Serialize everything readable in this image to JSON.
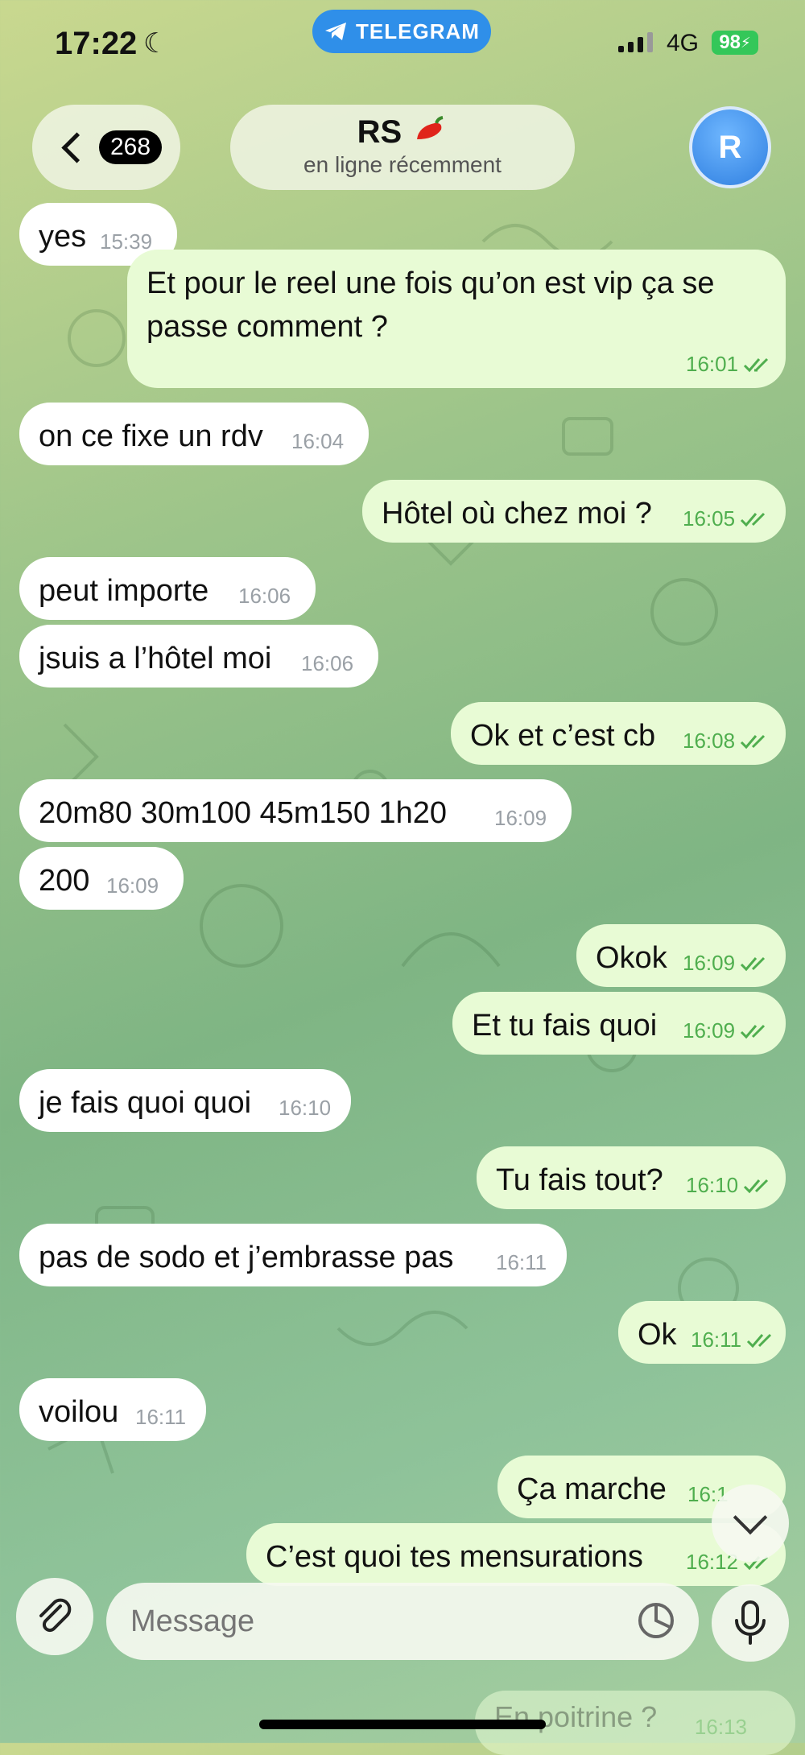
{
  "status_bar": {
    "time": "17:22",
    "network": "4G",
    "battery": "98",
    "pill_label": "TELEGRAM"
  },
  "header": {
    "back_count": "268",
    "chat_name": "RS",
    "chat_status": "en ligne récemment",
    "avatar_letter": "R"
  },
  "messages": [
    {
      "side": "in",
      "text": "yes",
      "time": "15:39"
    },
    {
      "side": "out",
      "text_line1": "Et pour le reel une fois qu’on est vip ça se",
      "text_line2": "passe comment ?",
      "time": "16:01"
    },
    {
      "side": "in",
      "text": "on ce fixe un rdv",
      "time": "16:04"
    },
    {
      "side": "out",
      "text": "Hôtel où chez moi ?",
      "time": "16:05"
    },
    {
      "side": "in",
      "text": "peut importe",
      "time": "16:06"
    },
    {
      "side": "in",
      "text": "jsuis a l’hôtel moi",
      "time": "16:06"
    },
    {
      "side": "out",
      "text": "Ok et c’est cb",
      "time": "16:08"
    },
    {
      "side": "in",
      "text": "20m80 30m100 45m150 1h20",
      "time": "16:09"
    },
    {
      "side": "in",
      "text": "200",
      "time": "16:09"
    },
    {
      "side": "out",
      "text": "Okok",
      "time": "16:09"
    },
    {
      "side": "out",
      "text": "Et tu fais quoi",
      "time": "16:09"
    },
    {
      "side": "in",
      "text": "je fais quoi quoi",
      "time": "16:10"
    },
    {
      "side": "out",
      "text": "Tu fais tout?",
      "time": "16:10"
    },
    {
      "side": "in",
      "text": "pas de sodo et j’embrasse pas",
      "time": "16:11"
    },
    {
      "side": "out",
      "text": "Ok",
      "time": "16:11"
    },
    {
      "side": "in",
      "text": "voilou",
      "time": "16:11"
    },
    {
      "side": "out",
      "text": "Ça marche",
      "time": "16:1"
    },
    {
      "side": "out",
      "text": "C’est quoi tes mensurations",
      "time": "16:12"
    },
    {
      "side": "out",
      "text": "En poitrine ?",
      "time": "16:13"
    }
  ],
  "composer": {
    "placeholder": "Message"
  },
  "colors": {
    "incoming": "#ffffff",
    "outgoing": "#e8fbd5",
    "accent": "#2f8fe9",
    "read_check": "#4fae4e"
  },
  "icons": [
    "moon-icon",
    "telegram-icon",
    "chevron-left-icon",
    "pepper-emoji",
    "double-check-icon",
    "chevron-down-icon",
    "paperclip-icon",
    "sticker-icon",
    "microphone-icon"
  ]
}
